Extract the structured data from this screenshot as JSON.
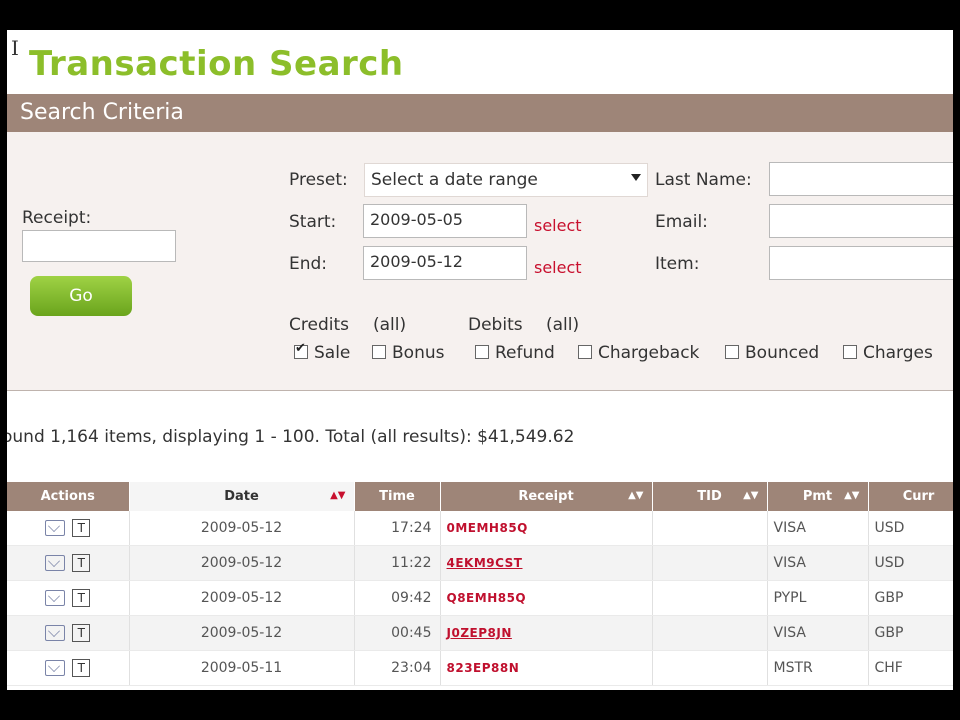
{
  "page": {
    "title": "Transaction Search",
    "cursor_glyph": "I"
  },
  "criteria": {
    "section_title": "Search Criteria",
    "receipt_label": "Receipt:",
    "receipt_value": "",
    "go_label": "Go",
    "preset_label": "Preset:",
    "preset_value": "Select a date range",
    "start_label": "Start:",
    "start_value": "2009-05-05",
    "end_label": "End:",
    "end_value": "2009-05-12",
    "select_link": "select",
    "last_name_label": "Last Name:",
    "email_label": "Email:",
    "item_label": "Item:",
    "credits_label": "Credits",
    "credits_all": "(all)",
    "debits_label": "Debits",
    "debits_all": "(all)",
    "checkboxes": [
      {
        "label": "Sale",
        "checked": true
      },
      {
        "label": "Bonus",
        "checked": false
      },
      {
        "label": "Refund",
        "checked": false
      },
      {
        "label": "Chargeback",
        "checked": false
      },
      {
        "label": "Bounced",
        "checked": false
      },
      {
        "label": "Charges",
        "checked": false
      }
    ]
  },
  "results": {
    "summary": "ound 1,164 items, displaying 1 - 100.    Total (all results): $41,549.62",
    "columns": [
      "Actions",
      "Date",
      "Time",
      "Receipt",
      "TID",
      "Pmt",
      "Curr"
    ],
    "rows": [
      {
        "date": "2009-05-12",
        "time": "17:24",
        "receipt": "0MEMH85Q",
        "tid": "",
        "pmt": "VISA",
        "curr": "USD"
      },
      {
        "date": "2009-05-12",
        "time": "11:22",
        "receipt": "4EKM9CST",
        "tid": "",
        "pmt": "VISA",
        "curr": "USD"
      },
      {
        "date": "2009-05-12",
        "time": "09:42",
        "receipt": "Q8EMH85Q",
        "tid": "",
        "pmt": "PYPL",
        "curr": "GBP"
      },
      {
        "date": "2009-05-12",
        "time": "00:45",
        "receipt": "J0ZEP8JN",
        "tid": "",
        "pmt": "VISA",
        "curr": "GBP"
      },
      {
        "date": "2009-05-11",
        "time": "23:04",
        "receipt": "823EP88N",
        "tid": "",
        "pmt": "MSTR",
        "curr": "CHF"
      }
    ],
    "action_t_label": "T",
    "icons": {
      "email": "envelope-icon",
      "text": "t-icon",
      "sort": "sort-arrows-icon"
    }
  }
}
